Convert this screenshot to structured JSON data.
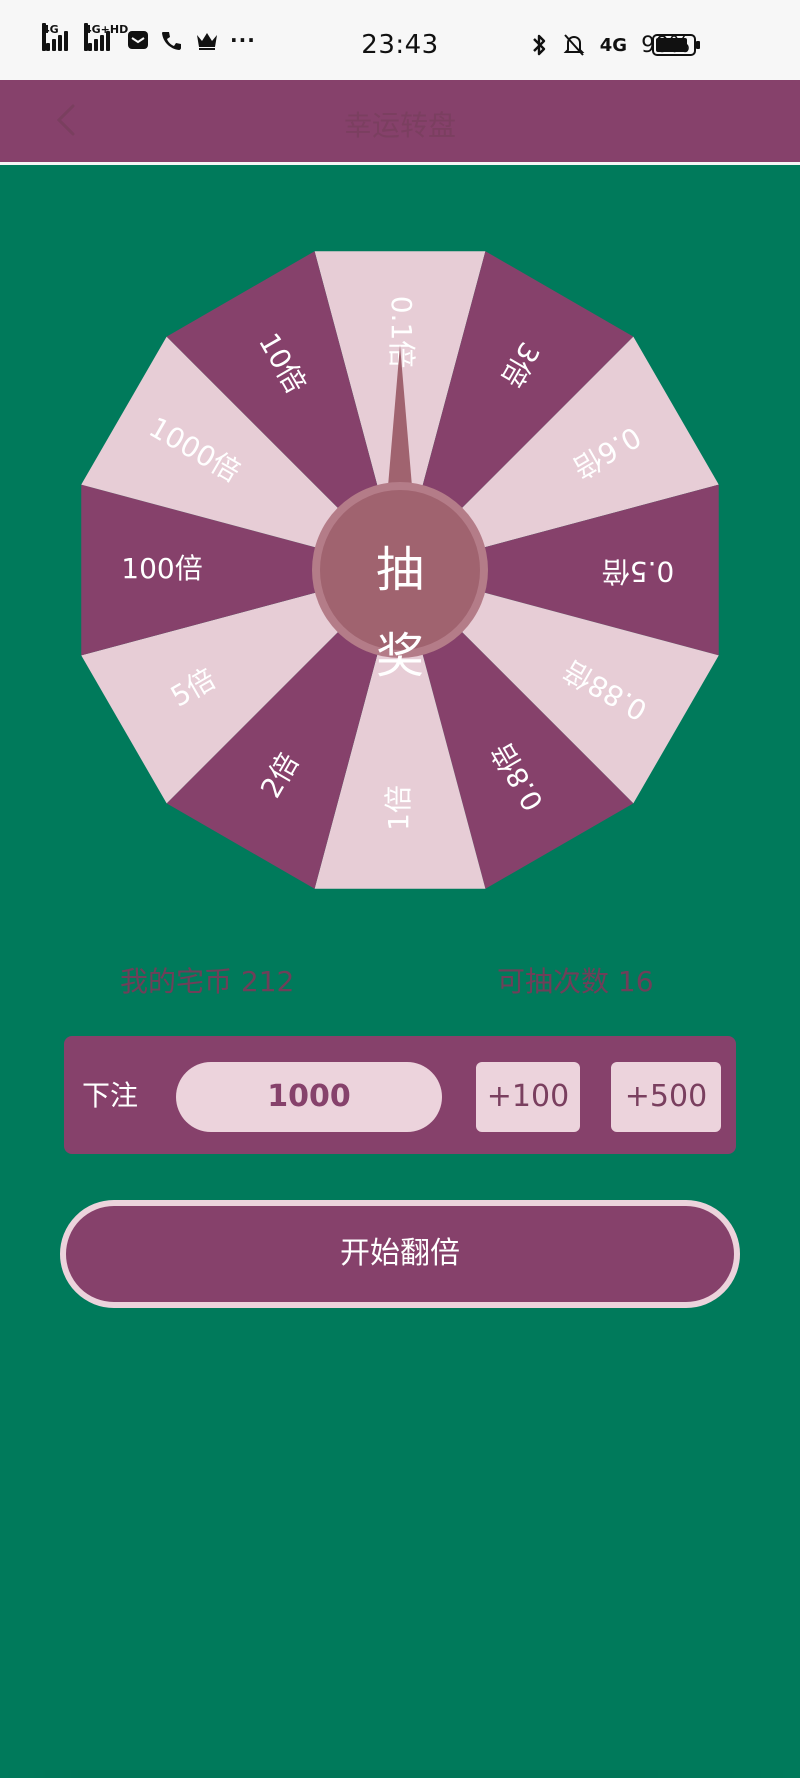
{
  "status_bar": {
    "time": "23:43",
    "battery_percent_text": "90%",
    "battery_level": 0.9,
    "signal_1_label": "4G",
    "signal_2_label": "4G+HD",
    "network_label": "4G",
    "more_dots": "···"
  },
  "app_bar": {
    "title": "幸运转盘",
    "back_icon": "chevron-left-icon"
  },
  "wheel": {
    "center_label": "抽奖",
    "segments": [
      "0.1倍",
      "3倍",
      "0.6倍",
      "0.5倍",
      "0.88倍",
      "0.8倍",
      "1倍",
      "2倍",
      "5倍",
      "100倍",
      "1000倍",
      "10倍"
    ],
    "colors": {
      "light": "#e7cdd6",
      "dark": "#86416b",
      "center": "#a0636f",
      "center_ring": "#b47c88",
      "pointer": "#a0636f"
    }
  },
  "info": {
    "coins_label": "我的宅币",
    "coins_value": "212",
    "spins_label": "可抽次数",
    "spins_value": "16"
  },
  "bet": {
    "label": "下注",
    "amount": "1000",
    "add_100": "+100",
    "add_500": "+500"
  },
  "start_button": {
    "label": "开始翻倍"
  }
}
